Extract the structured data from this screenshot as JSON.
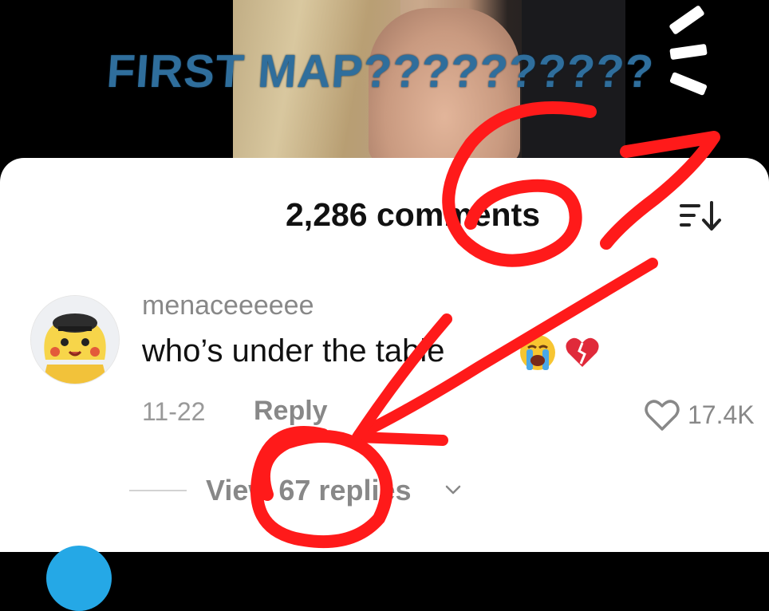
{
  "video": {
    "overlay_text": "FIRST MAP??????????",
    "overlay_color": "#2f6e9c"
  },
  "comments_panel": {
    "title": "2,286 comments",
    "sort_icon": "sort-icon",
    "comment": {
      "username": "menaceeeeee",
      "text": "who’s under the table",
      "emojis": [
        "loudly-crying-face",
        "broken-heart"
      ],
      "date": "11-22",
      "reply_label": "Reply",
      "like_count": "17.4K",
      "view_replies_label": "View 67 replies"
    }
  },
  "annotations": {
    "scribble_number": "67",
    "scribble_color": "#ff0000"
  }
}
